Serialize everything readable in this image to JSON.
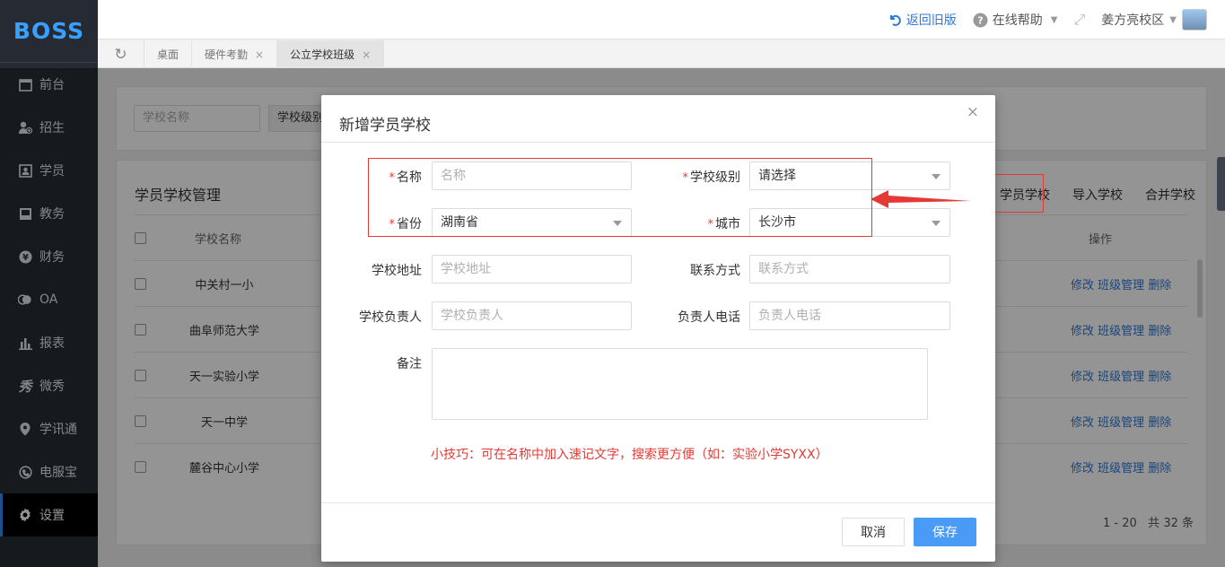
{
  "sidebar": {
    "logo": "BOSS",
    "items": [
      {
        "label": "前台",
        "icon": "calendar-icon"
      },
      {
        "label": "招生",
        "icon": "add-user-icon"
      },
      {
        "label": "学员",
        "icon": "id-card-icon"
      },
      {
        "label": "教务",
        "icon": "book-icon"
      },
      {
        "label": "财务",
        "icon": "yen-icon"
      },
      {
        "label": "OA",
        "icon": "oa-icon"
      },
      {
        "label": "报表",
        "icon": "bar-chart-icon"
      },
      {
        "label": "微秀",
        "icon": "xiu-icon"
      },
      {
        "label": "学讯通",
        "icon": "location-icon"
      },
      {
        "label": "电服宝",
        "icon": "phone-icon"
      },
      {
        "label": "设置",
        "icon": "gear-icon"
      }
    ],
    "active_index": 10
  },
  "topbar": {
    "back_label": "返回旧版",
    "help_label": "在线帮助",
    "campus_label": "姜方亮校区"
  },
  "tabs": [
    {
      "label": "桌面",
      "closable": false
    },
    {
      "label": "硬件考勤",
      "closable": true
    },
    {
      "label": "公立学校班级",
      "closable": true,
      "active": true
    }
  ],
  "background": {
    "search_placeholder": "学校名称",
    "level_filter": "学校级别",
    "panel_title": "学员学校管理",
    "actions": [
      "学员学校",
      "导入学校",
      "合并学校"
    ],
    "header_name": "学校名称",
    "header_ops": "操作",
    "rows": [
      "中关村一小",
      "曲阜师范大学",
      "天一实验小学",
      "天一中学",
      "麓谷中心小学"
    ],
    "op_edit": "修改",
    "op_class": "班级管理",
    "op_delete": "删除",
    "pagination": "1 - 20   共 32 条"
  },
  "modal": {
    "title": "新增学员学校",
    "close_label": "×",
    "fields": {
      "name": {
        "label": "名称",
        "placeholder": "名称",
        "required": true
      },
      "level": {
        "label": "学校级别",
        "value": "请选择",
        "required": true
      },
      "province": {
        "label": "省份",
        "value": "湖南省",
        "required": true
      },
      "city": {
        "label": "城市",
        "value": "长沙市",
        "required": true
      },
      "address": {
        "label": "学校地址",
        "placeholder": "学校地址"
      },
      "contact": {
        "label": "联系方式",
        "placeholder": "联系方式"
      },
      "principal": {
        "label": "学校负责人",
        "placeholder": "学校负责人"
      },
      "principal_phone": {
        "label": "负责人电话",
        "placeholder": "负责人电话"
      },
      "remark": {
        "label": "备注"
      }
    },
    "required_mark": "*",
    "tip": "小技巧：可在名称中加入速记文字，搜索更方便（如：实验小学SYXX）",
    "cancel_label": "取消",
    "save_label": "保存"
  },
  "colors": {
    "sidebar_bg": "#262b33",
    "accent": "#2f8cf0",
    "primary_button": "#4a9bf5",
    "required": "#e53935",
    "annotation_red": "#e53935"
  }
}
